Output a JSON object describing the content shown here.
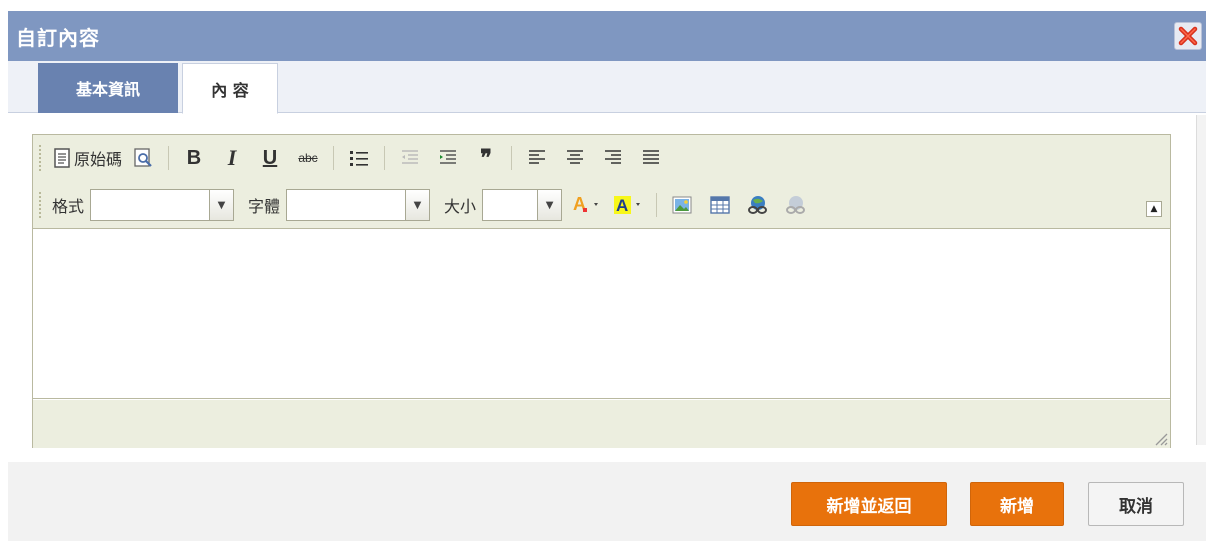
{
  "dialog": {
    "title": "自訂內容"
  },
  "tabs": [
    {
      "label": "基本資訊"
    },
    {
      "label": "內 容"
    }
  ],
  "toolbar": {
    "source_label": "原始碼",
    "format_label": "格式",
    "font_label": "字體",
    "size_label": "大小",
    "format_value": "",
    "font_value": "",
    "size_value": ""
  },
  "footer": {
    "save_return_label": "新增並返回",
    "save_label": "新增",
    "cancel_label": "取消"
  },
  "colors": {
    "title_bar": "#7f97c1",
    "active_tab": "#6982b0",
    "primary_button": "#e8720c",
    "toolbar_bg": "#eceedf"
  }
}
